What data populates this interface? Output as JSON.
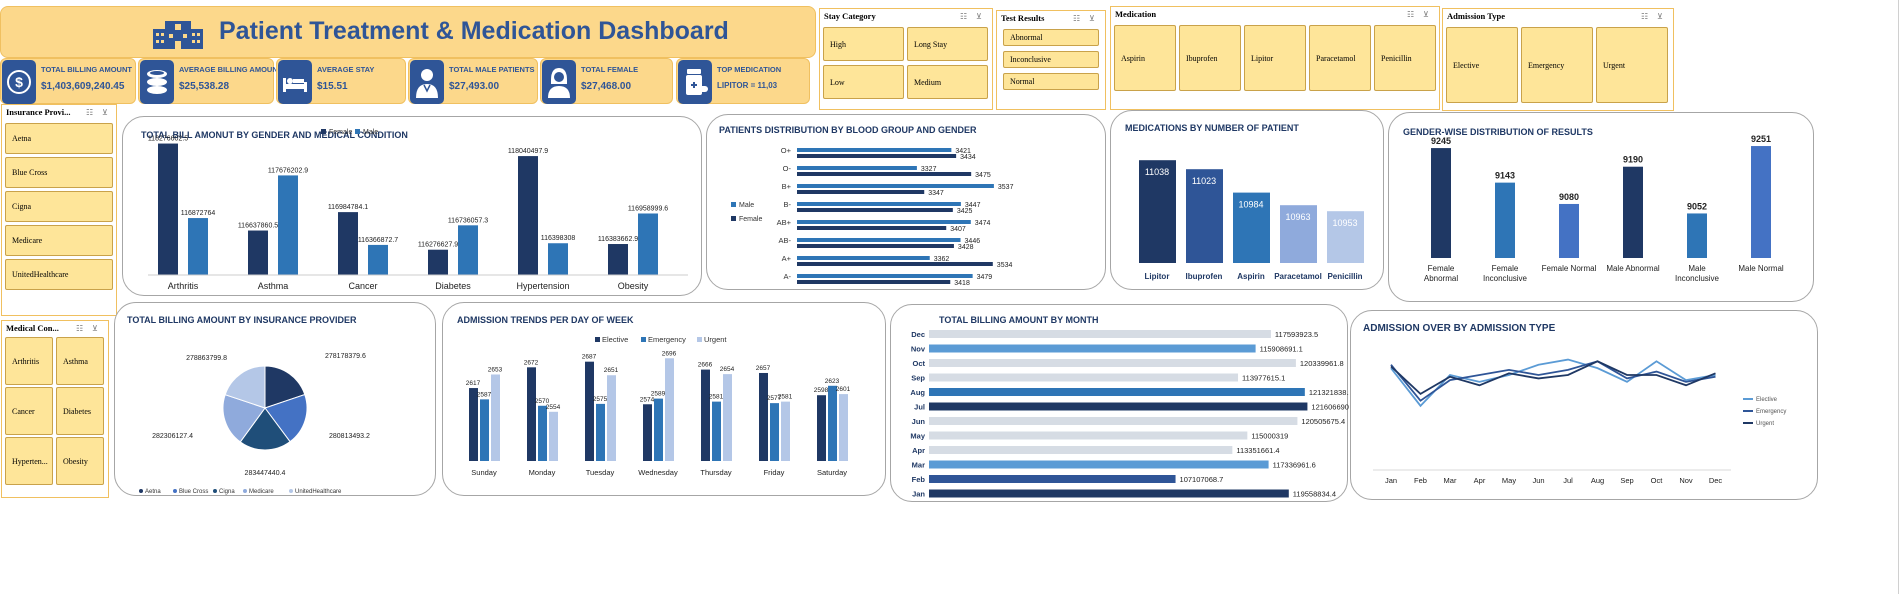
{
  "header": {
    "title": "Patient Treatment & Medication Dashboard"
  },
  "kpis": [
    {
      "label": "TOTAL BILLING AMOUNT",
      "value": "$1,403,609,240.45",
      "icon": "dollar-icon"
    },
    {
      "label": "AVERAGE BILLING AMOUNT",
      "value": "$25,538.28",
      "icon": "coins-icon"
    },
    {
      "label": "AVERAGE STAY",
      "value": "$15.51",
      "icon": "bed-icon"
    },
    {
      "label": "TOTAL MALE PATIENTS",
      "value": "$27,493.00",
      "icon": "male-doctor-icon"
    },
    {
      "label": "TOTAL FEMALE",
      "value": "$27,468.00",
      "icon": "female-doctor-icon"
    },
    {
      "label": "TOP MEDICATION",
      "value": "LIPITOR = 11,03",
      "icon": "pill-bottle-icon"
    }
  ],
  "slicers": {
    "stay": {
      "title": "Stay Category",
      "items": [
        "High",
        "Long Stay",
        "Low",
        "Medium"
      ]
    },
    "test": {
      "title": "Test Results",
      "items": [
        "Abnormal",
        "Inconclusive",
        "Normal"
      ]
    },
    "medication": {
      "title": "Medication",
      "items": [
        "Aspirin",
        "Ibuprofen",
        "Lipitor",
        "Paracetamol",
        "Penicillin"
      ]
    },
    "admission": {
      "title": "Admission Type",
      "items": [
        "Elective",
        "Emergency",
        "Urgent"
      ]
    },
    "insurance": {
      "title": "Insurance Provi...",
      "items": [
        "Aetna",
        "Blue Cross",
        "Cigna",
        "Medicare",
        "UnitedHealthcare"
      ]
    },
    "condition": {
      "title": "Medical Con...",
      "items": [
        "Arthritis",
        "Asthma",
        "Cancer",
        "Diabetes",
        "Hyperten...",
        "Obesity"
      ]
    }
  },
  "colors": {
    "dark": "#1f3864",
    "mid": "#2e75b6",
    "light": "#b4c7e7",
    "blue": "#4472c4",
    "banner": "#fcd88b"
  },
  "chart_data": [
    {
      "id": "bill-gender-condition",
      "type": "bar",
      "title": "TOTAL BILL AMONUT BY GENDER AND MEDICAL CONDITION",
      "categories": [
        "Arthritis",
        "Asthma",
        "Cancer",
        "Diabetes",
        "Hypertension",
        "Obesity"
      ],
      "series": [
        {
          "name": "Female",
          "values": [
            118276602.5,
            116637860.5,
            116984784.1,
            116276627.9,
            118040497.9,
            116383662.9
          ],
          "labels": [
            "118276602.5",
            "116637860.5",
            "116984784.1",
            "116276627.9",
            "118040497.9",
            "116383662.9"
          ]
        },
        {
          "name": "Male",
          "values": [
            116872764,
            117676202.9,
            116366872.7,
            116736057.3,
            116398308,
            116958999.6
          ],
          "labels": [
            "116872764",
            "117676202.9",
            "116366872.7",
            "116736057.3",
            "116398308",
            "116958999.6"
          ]
        }
      ],
      "ylim": [
        115800000,
        118400000
      ]
    },
    {
      "id": "blood-gender",
      "type": "bar",
      "title": "PATIENTS  DISTRIBUTION BY BLOOD GROUP AND GENDER",
      "categories": [
        "O+",
        "O-",
        "B+",
        "B-",
        "AB+",
        "AB-",
        "A+",
        "A-"
      ],
      "series": [
        {
          "name": "Male",
          "values": [
            3421,
            3327,
            3537,
            3447,
            3474,
            3446,
            3362,
            3479
          ]
        },
        {
          "name": "Female",
          "values": [
            3434,
            3475,
            3347,
            3425,
            3407,
            3428,
            3534,
            3418
          ]
        }
      ],
      "xlim": [
        3000,
        3600
      ]
    },
    {
      "id": "medications-patients",
      "type": "bar",
      "title": "MEDICATIONS BY NUMBER OF PATIENT",
      "categories": [
        "Lipitor",
        "Ibuprofen",
        "Aspirin",
        "Paracetamol",
        "Penicillin"
      ],
      "values": [
        11038,
        11023,
        10984,
        10963,
        10953
      ],
      "ylim": [
        10900,
        11060
      ]
    },
    {
      "id": "gender-results",
      "type": "bar",
      "title": "GENDER-WISE DISTRIBUTION OF RESULTS",
      "categories": [
        "Female Abnormal",
        "Female Inconclusive",
        "Female Normal",
        "Male Abnormal",
        "Male Inconclusive",
        "Male Normal"
      ],
      "values": [
        9245,
        9143,
        9080,
        9190,
        9052,
        9251
      ],
      "ylim": [
        8950,
        9260
      ]
    },
    {
      "id": "billing-insurance",
      "type": "pie",
      "title": "TOTAL BILLING AMOUNT BY INSURANCE PROVIDER",
      "categories": [
        "Aetna",
        "Blue Cross",
        "Cigna",
        "Medicare",
        "UnitedHealthcare"
      ],
      "values": [
        278178379.6,
        280813493.2,
        283447440.4,
        282306127.4,
        278863799.8
      ],
      "labels": [
        "278178379.6",
        "280813493.2",
        "283447440.4",
        "282306127.4",
        "278863799.8"
      ]
    },
    {
      "id": "admission-weekday",
      "type": "bar",
      "title": "ADMISSION TRENDS PER DAY OF WEEK",
      "categories": [
        "Sunday",
        "Monday",
        "Tuesday",
        "Wednesday",
        "Thursday",
        "Friday",
        "Saturday"
      ],
      "series": [
        {
          "name": "Elective",
          "values": [
            2617,
            2672,
            2687,
            2574,
            2666,
            2657,
            2598
          ]
        },
        {
          "name": "Emergency",
          "values": [
            2587,
            2570,
            2575,
            2589,
            2581,
            2577,
            2623
          ]
        },
        {
          "name": "Urgent",
          "values": [
            2653,
            2554,
            2651,
            2696,
            2654,
            2581,
            2601
          ]
        }
      ],
      "ylim": [
        2450,
        2710
      ]
    },
    {
      "id": "billing-month",
      "type": "bar",
      "title": "TOTAL BILLING AMOUNT BY MONTH",
      "categories": [
        "Dec",
        "Nov",
        "Oct",
        "Sep",
        "Aug",
        "Jul",
        "Jun",
        "May",
        "Apr",
        "Mar",
        "Feb",
        "Jan"
      ],
      "values": [
        117593923.5,
        115908691.1,
        120339961.8,
        113977615.1,
        121321838.2,
        121606690.1,
        120505675.4,
        115000319,
        113351661.4,
        117336961.6,
        107107068.7,
        119558834.4
      ],
      "labels": [
        "117593923.5",
        "115908691.1",
        "120339961.8",
        "113977615.1",
        "121321838.2",
        "121606690.1",
        "120505675.4",
        "115000319",
        "113351661.4",
        "117336961.6",
        "107107068.7",
        "119558834.4"
      ],
      "xlim": [
        80000000,
        122000000
      ]
    },
    {
      "id": "admission-month",
      "type": "line",
      "title": "ADMISSION OVER BY ADMISSION TYPE",
      "categories": [
        "Jan",
        "Feb",
        "Mar",
        "Apr",
        "May",
        "Jun",
        "Jul",
        "Aug",
        "Sep",
        "Oct",
        "Nov",
        "Dec"
      ],
      "series": [
        {
          "name": "Elective",
          "values": [
            1600,
            1380,
            1560,
            1520,
            1560,
            1620,
            1650,
            1600,
            1520,
            1640,
            1530,
            1560
          ]
        },
        {
          "name": "Emergency",
          "values": [
            1620,
            1410,
            1530,
            1560,
            1590,
            1560,
            1590,
            1640,
            1540,
            1580,
            1520,
            1550
          ]
        },
        {
          "name": "Urgent",
          "values": [
            1610,
            1450,
            1550,
            1500,
            1570,
            1540,
            1560,
            1640,
            1560,
            1560,
            1500,
            1570
          ]
        }
      ],
      "ylim": [
        1350,
        1700
      ]
    }
  ]
}
